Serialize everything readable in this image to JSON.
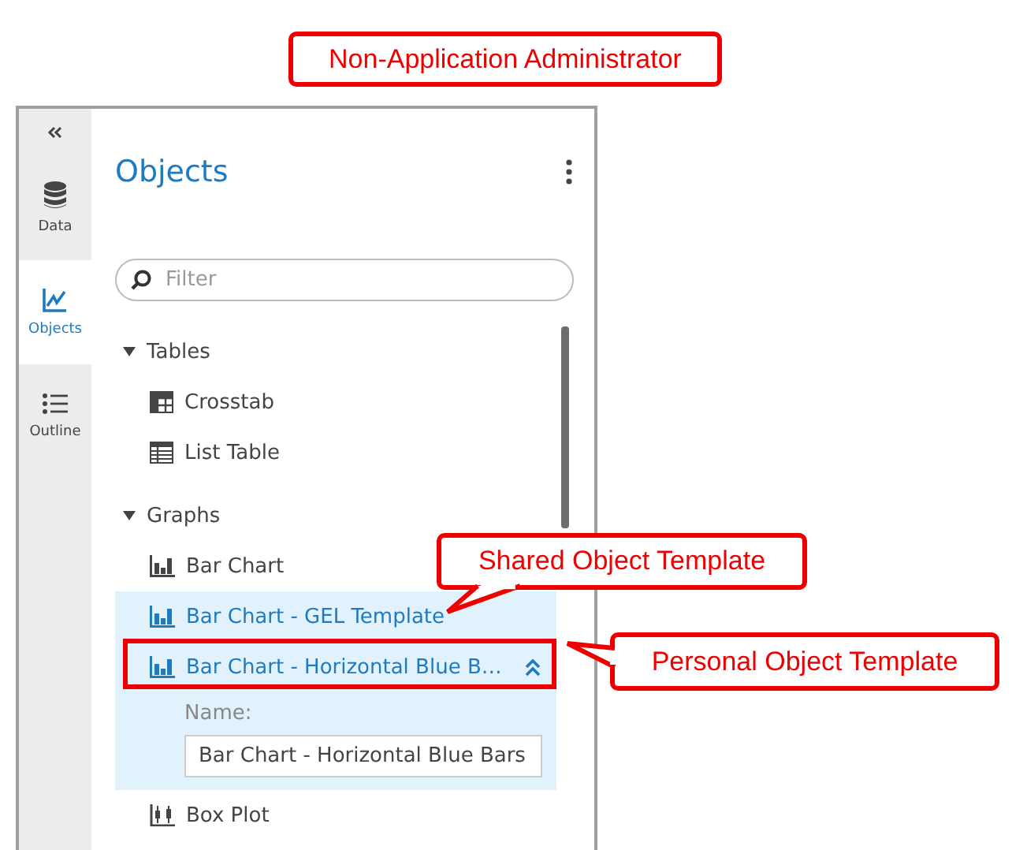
{
  "annotations": [
    {
      "kind": "banner",
      "text": "Non-Application Administrator"
    },
    {
      "kind": "callout-below",
      "text": "Shared Object Template"
    },
    {
      "kind": "callout-left",
      "text": "Personal Object Template"
    },
    {
      "kind": "frame"
    }
  ],
  "rail": {
    "items": [
      {
        "kind": "data",
        "label": "Data",
        "selected": false
      },
      {
        "kind": "objects",
        "label": "Objects",
        "selected": true
      },
      {
        "kind": "outline",
        "label": "Outline",
        "selected": false
      }
    ]
  },
  "panel": {
    "title": "Objects",
    "filter": {
      "placeholder": "Filter"
    },
    "groups": [
      {
        "label": "Tables",
        "expanded": true,
        "items": [
          {
            "kind": "crosstab",
            "label": "Crosstab",
            "selected": false,
            "expanded": false
          },
          {
            "kind": "list-table",
            "label": "List Table",
            "selected": false,
            "expanded": false
          }
        ]
      },
      {
        "label": "Graphs",
        "expanded": true,
        "items": [
          {
            "kind": "bar-chart",
            "label": "Bar Chart",
            "selected": false,
            "expanded": false
          },
          {
            "kind": "bar-chart",
            "label": "Bar Chart - GEL Template",
            "selected": true,
            "expanded": false
          },
          {
            "kind": "bar-chart",
            "label": "Bar Chart - Horizontal Blue B…",
            "selected": true,
            "expanded": true,
            "name_label": "Name:",
            "name_value": "Bar Chart - Horizontal Blue Bars"
          },
          {
            "kind": "box-plot",
            "label": "Box Plot",
            "selected": false,
            "expanded": false
          }
        ]
      }
    ]
  }
}
